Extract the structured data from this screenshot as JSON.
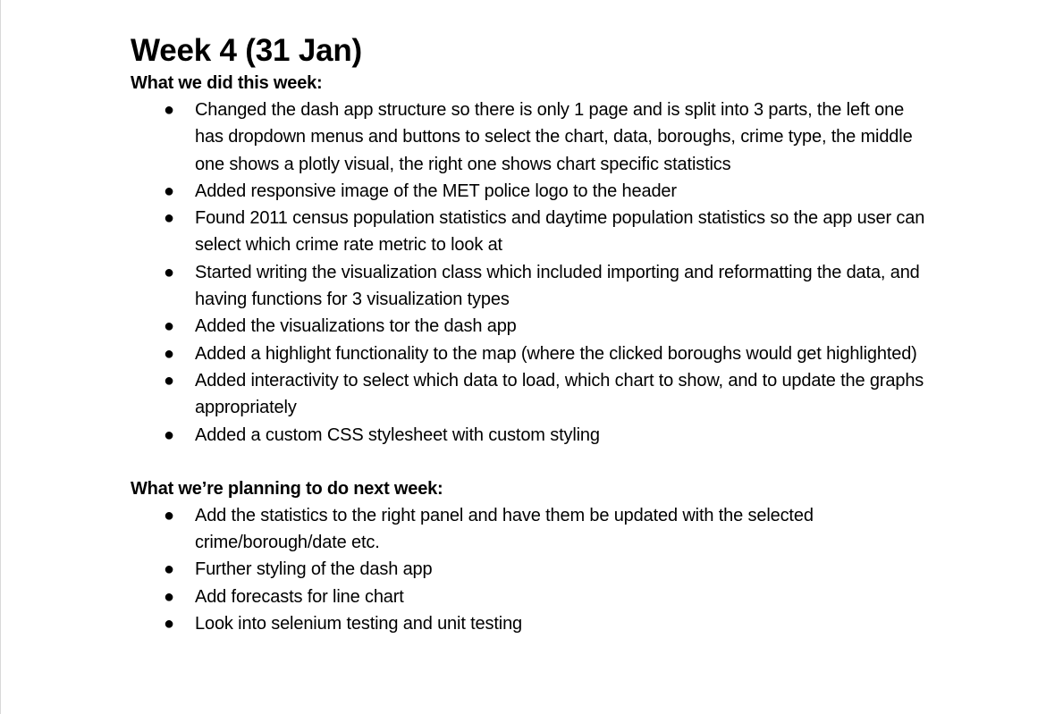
{
  "document": {
    "title": "Week 4 (31 Jan)",
    "sections": [
      {
        "heading": "What we did this week:",
        "items": [
          "Changed the dash app structure so there is only 1 page and is split into 3 parts, the left one has dropdown menus and buttons to select the chart, data, boroughs, crime type, the middle one shows a plotly visual, the right one shows chart specific statistics",
          "Added responsive image of the MET police logo to the header",
          "Found 2011 census population statistics and daytime population statistics so the app user can select which crime rate metric to look at",
          "Started writing the visualization class which included importing and reformatting the data, and having functions for 3 visualization types",
          "Added the visualizations tor the dash app",
          "Added a highlight functionality to the map (where the clicked boroughs would get highlighted)",
          "Added interactivity to select which data to load, which chart to show, and to update the graphs appropriately",
          "Added a custom CSS stylesheet with custom styling"
        ]
      },
      {
        "heading": "What we’re planning to do next week:",
        "items": [
          "Add the statistics to the right panel and have them be updated with the selected crime/borough/date etc.",
          "Further styling of the dash app",
          "Add forecasts for line chart",
          "Look into selenium testing and unit testing"
        ]
      }
    ],
    "bullet_glyph": "●"
  }
}
